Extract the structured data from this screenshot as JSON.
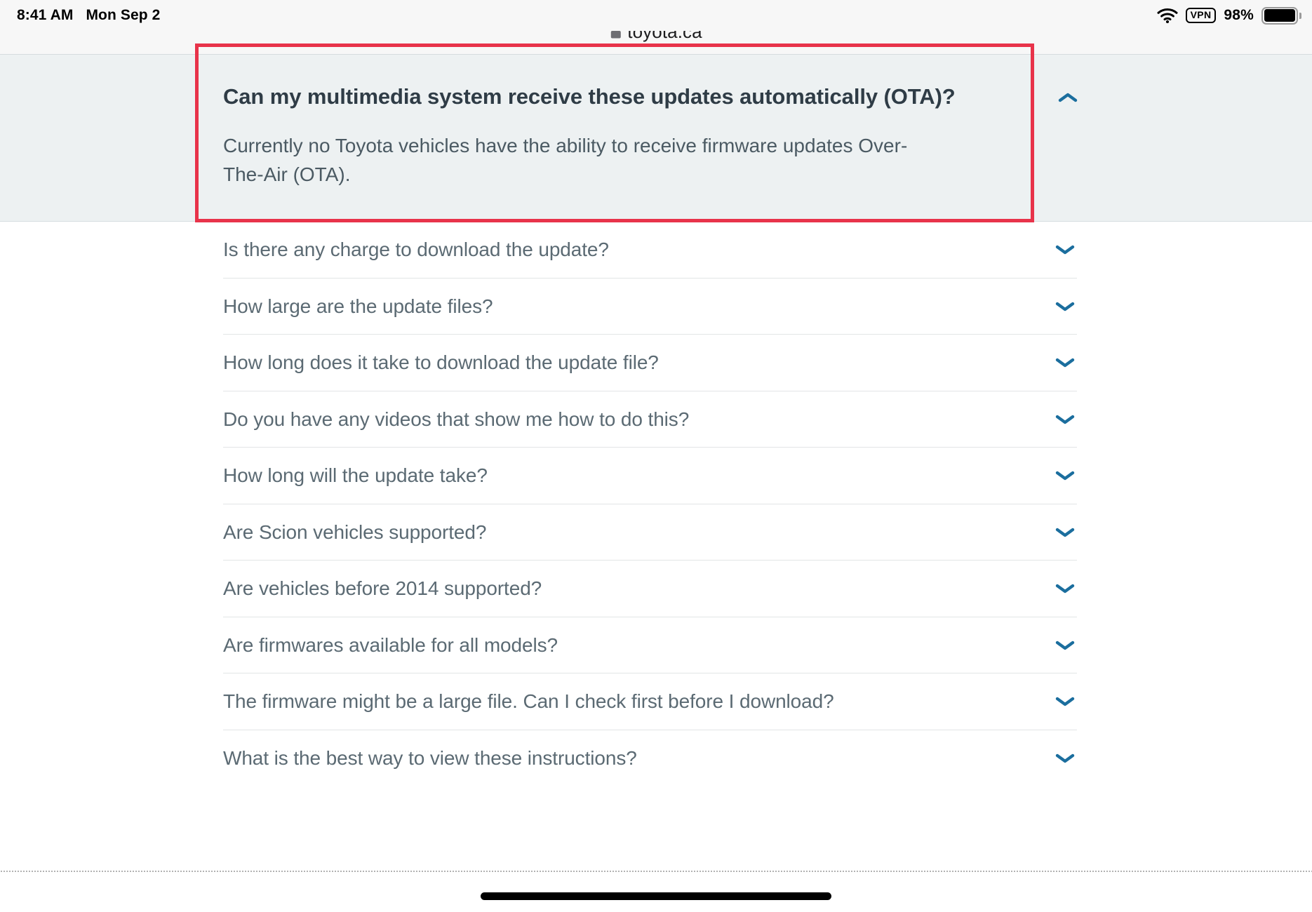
{
  "status_bar": {
    "time": "8:41 AM",
    "date": "Mon Sep 2",
    "wifi_icon": "wifi-icon",
    "vpn_label": "VPN",
    "battery_percent": "98%",
    "battery_icon": "battery-full-icon"
  },
  "browser": {
    "multitask_handle_icon": "three-dots-icon",
    "lock_icon": "lock-icon",
    "url": "toyota.ca"
  },
  "expanded_faq": {
    "question": "Can my multimedia system receive these updates automatically (OTA)?",
    "answer": "Currently no Toyota vehicles have the ability to receive firmware updates Over-The-Air (OTA).",
    "chevron_icon": "chevron-up-icon",
    "expanded": true,
    "background_color": "#edf1f2"
  },
  "faq_items": [
    {
      "question": "Is there any charge to download the update?",
      "chevron_icon": "chevron-down-icon"
    },
    {
      "question": "How large are the update files?",
      "chevron_icon": "chevron-down-icon"
    },
    {
      "question": "How long does it take to download the update file?",
      "chevron_icon": "chevron-down-icon"
    },
    {
      "question": "Do you have any videos that show me how to do this?",
      "chevron_icon": "chevron-down-icon"
    },
    {
      "question": "How long will the update take?",
      "chevron_icon": "chevron-down-icon"
    },
    {
      "question": "Are Scion vehicles supported?",
      "chevron_icon": "chevron-down-icon"
    },
    {
      "question": "Are vehicles before 2014 supported?",
      "chevron_icon": "chevron-down-icon"
    },
    {
      "question": "Are firmwares available for all models?",
      "chevron_icon": "chevron-down-icon"
    },
    {
      "question": "The firmware might be a large file. Can I check first before I download?",
      "chevron_icon": "chevron-down-icon"
    },
    {
      "question": "What is the best way to view these instructions?",
      "chevron_icon": "chevron-down-icon"
    }
  ],
  "annotation": {
    "type": "highlight-box",
    "color": "#e8334a"
  },
  "colors": {
    "chevron_blue": "#1b6e9e",
    "question_text": "#5b6a73",
    "heading_text": "#2f3c46",
    "panel_background": "#edf1f2",
    "divider": "#e2e5e6"
  },
  "home_indicator": "home-indicator"
}
